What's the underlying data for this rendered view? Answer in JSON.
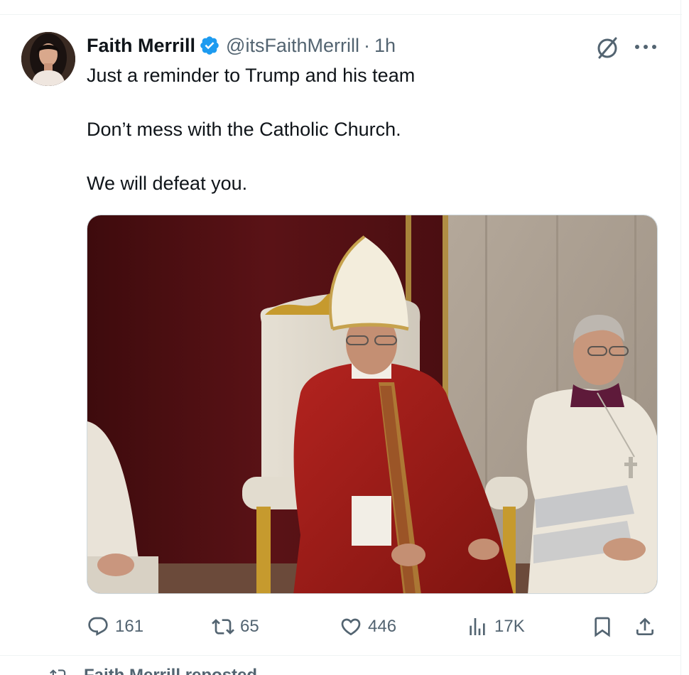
{
  "tweet": {
    "author": {
      "display_name": "Faith Merrill",
      "handle": "@itsFaithMerrill",
      "verified": true
    },
    "separator": "·",
    "timestamp": "1h",
    "text": [
      "Just a reminder to Trump and his team",
      "Don’t mess with the Catholic Church.",
      "We will defeat you."
    ],
    "media": {
      "type": "photo"
    },
    "stats": {
      "replies": "161",
      "reposts": "65",
      "likes": "446",
      "views": "17K"
    }
  },
  "next_item": {
    "repost_label": "Faith Merrill reposted"
  },
  "icons": {
    "verified": "verified-badge-icon",
    "grok": "grok-icon",
    "more": "more-icon",
    "reply": "reply-icon",
    "repost": "repost-icon",
    "like": "like-icon",
    "views": "views-icon",
    "bookmark": "bookmark-icon",
    "share": "share-icon"
  },
  "colors": {
    "primary_text": "#0f1419",
    "secondary_text": "#536471",
    "verified_blue": "#1d9bf0",
    "border": "#eff3f4"
  }
}
